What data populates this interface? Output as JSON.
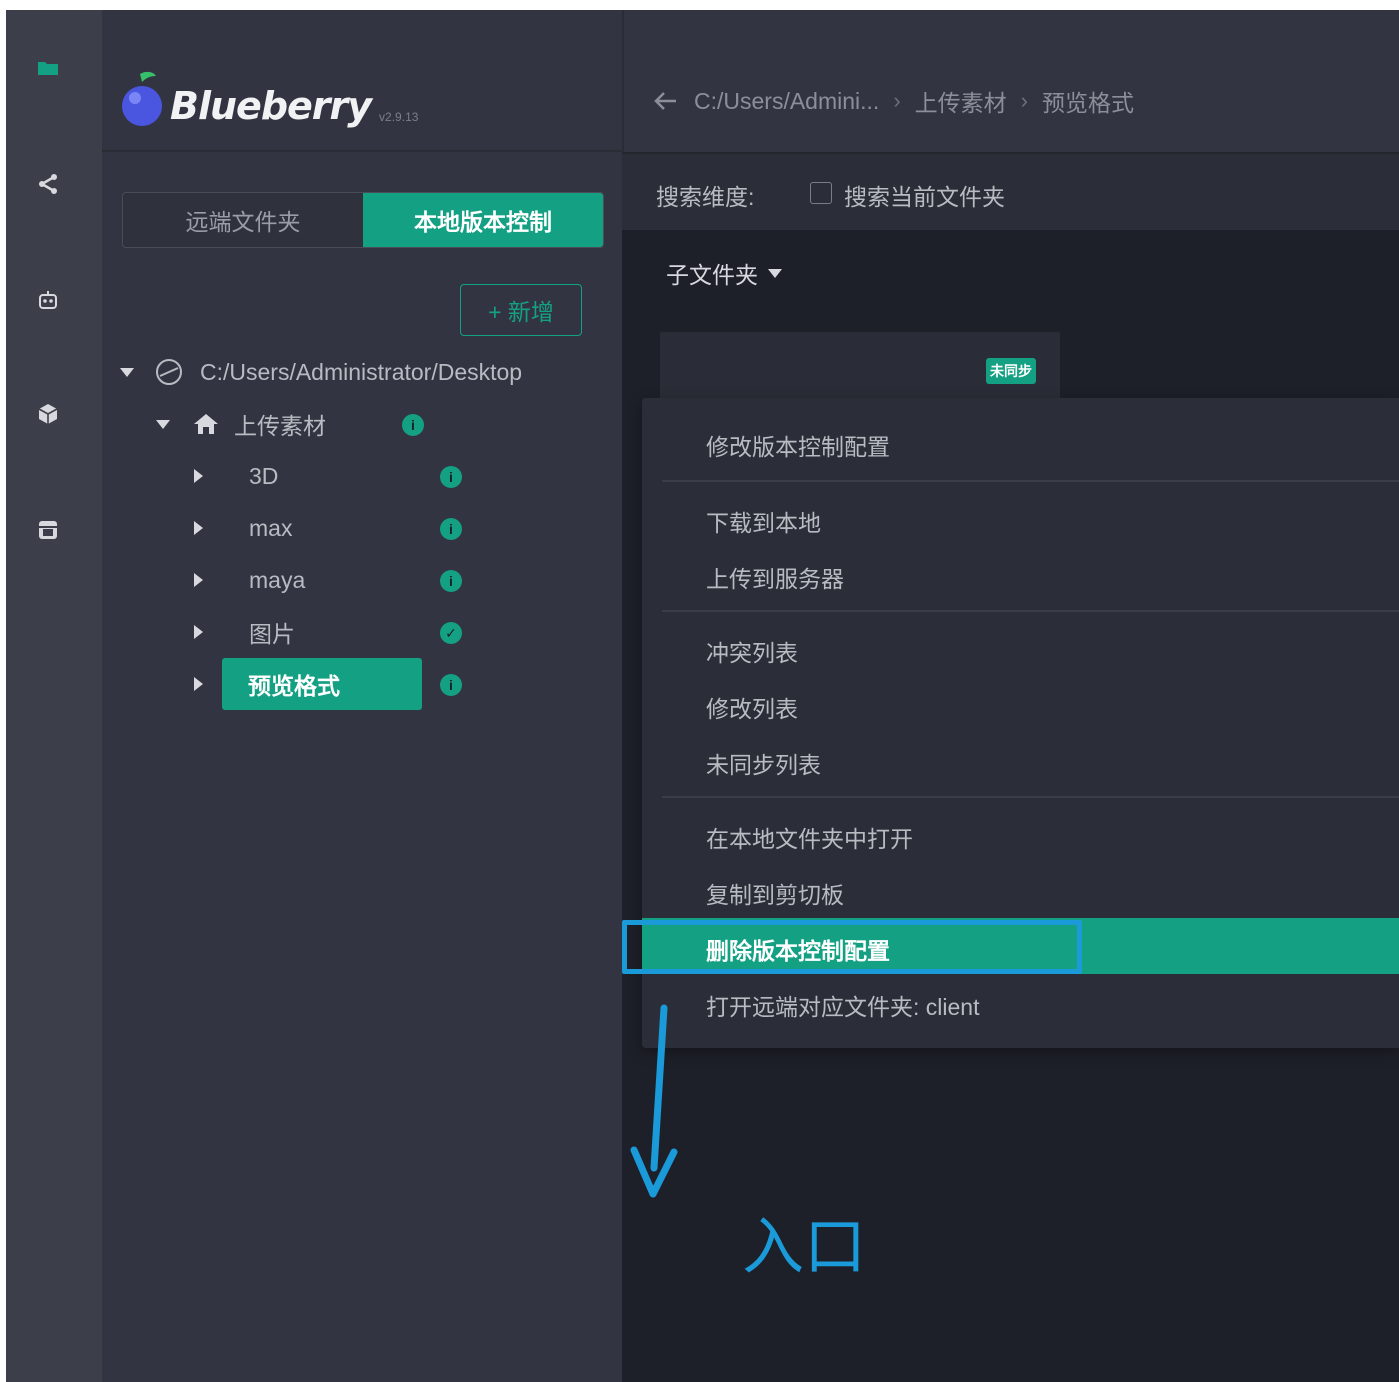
{
  "app": {
    "name": "Blueberry",
    "version": "v2.9.13"
  },
  "rail": {
    "icons": [
      "folder-icon",
      "share-icon",
      "robot-icon",
      "cube-icon",
      "store-icon"
    ]
  },
  "sidebar": {
    "tabs": [
      {
        "label": "远端文件夹",
        "active": false
      },
      {
        "label": "本地版本控制",
        "active": true
      }
    ],
    "new_button": "+ 新增",
    "tree": {
      "root_path": "C:/Users/Administrator/Desktop",
      "upload_folder": "上传素材",
      "children": [
        {
          "label": "3D",
          "status": "info"
        },
        {
          "label": "max",
          "status": "info"
        },
        {
          "label": "maya",
          "status": "info"
        },
        {
          "label": "图片",
          "status": "synced"
        },
        {
          "label": "预览格式",
          "status": "info",
          "selected": true
        }
      ]
    }
  },
  "main": {
    "breadcrumb": [
      "C:/Users/Admini...",
      "上传素材",
      "预览格式"
    ],
    "search": {
      "label": "搜索维度:",
      "checkbox_label": "搜索当前文件夹",
      "checked": false
    },
    "subfolder_label": "子文件夹",
    "card_badge": "未同步"
  },
  "context_menu": {
    "items": [
      "修改版本控制配置",
      "下载到本地",
      "上传到服务器",
      "冲突列表",
      "修改列表",
      "未同步列表",
      "在本地文件夹中打开",
      "复制到剪切板",
      "删除版本控制配置",
      "打开远端对应文件夹: client"
    ],
    "active_item": "删除版本控制配置"
  },
  "annotation": {
    "text": "入口",
    "color": "#1a9ad8"
  },
  "colors": {
    "accent": "#14a083",
    "rail_bg": "#3c3f4a",
    "sidebar_bg": "#323541",
    "main_bg": "#1e2029",
    "annotation": "#1a9ad8"
  }
}
